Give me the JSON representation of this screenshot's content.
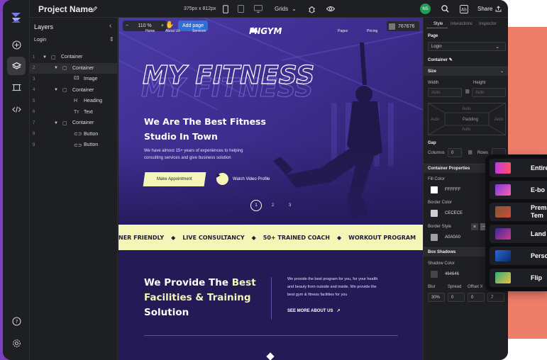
{
  "app": {
    "project_name": "Project Name",
    "viewport": "375px x 812px",
    "grids_label": "Grids",
    "avatar_initials": "NS",
    "share_label": "Share"
  },
  "layers": {
    "title": "Layers",
    "page": "Login",
    "rows": [
      {
        "n": "1",
        "label": "Container",
        "icon": "box-icon",
        "depth": 0,
        "expand": true
      },
      {
        "n": "2",
        "label": "Container",
        "icon": "box-icon",
        "depth": 1,
        "expand": true
      },
      {
        "n": "3",
        "label": "Image",
        "icon": "image-icon",
        "depth": 2,
        "expand": false
      },
      {
        "n": "4",
        "label": "Container",
        "icon": "box-icon",
        "depth": 1,
        "expand": true
      },
      {
        "n": "5",
        "label": "Heading",
        "icon": "heading-icon",
        "depth": 2,
        "expand": false
      },
      {
        "n": "6",
        "label": "Text",
        "icon": "text-icon",
        "depth": 2,
        "expand": false
      },
      {
        "n": "7",
        "label": "Container",
        "icon": "box-icon",
        "depth": 1,
        "expand": true
      },
      {
        "n": "8",
        "label": "Button",
        "icon": "link-icon",
        "depth": 2,
        "expand": false
      },
      {
        "n": "9",
        "label": "Button",
        "icon": "link-icon",
        "depth": 2,
        "expand": false
      }
    ]
  },
  "canvas_toolbar": {
    "zoom": "110 %",
    "add_page": "Add page",
    "color_chip": "767676"
  },
  "site": {
    "brand": "MIGYM",
    "nav": [
      "Home",
      "About Us",
      "Services",
      "Pages",
      "Pricing"
    ],
    "big_title": "MY FITNESS",
    "headline_1": "We Are The Best Fitness",
    "headline_2": "Studio In Town",
    "sub_1": "We have almost 15+ years of experiences to helping",
    "sub_2": "consulting services and give business solution",
    "cta": "Make Appointment",
    "video": "Watch Video Profile",
    "slides": [
      "1",
      "2",
      "3"
    ],
    "marquee": [
      "NER FRIENDLY",
      "LIVE CONSULTANCY",
      "50+ TRAINED COACH",
      "WORKOUT PROGRAM",
      "50"
    ],
    "provide_1a": "We Provide The ",
    "provide_1b": "Best",
    "provide_2": "Facilities & Training",
    "provide_3": "Solution",
    "para_1": "We provide the best program for you, for your health",
    "para_2": "and beauty from outside and inside. We provide the",
    "para_3": "best gym & fitness facilities for you",
    "see_more": "SEE MORE ABOUT US"
  },
  "props": {
    "tabs": [
      "Style",
      "Interactions",
      "Inspector"
    ],
    "page_label": "Page",
    "page_value": "Login",
    "container_label": "Container",
    "size_label": "Size",
    "width_label": "Width",
    "height_label": "Height",
    "auto": "Auto",
    "padding": "Padding",
    "gap_label": "Gap",
    "columns_label": "Columns",
    "columns_value": "0",
    "rows_label": "Rows",
    "container_props": "Container Properties",
    "fill_label": "Fill Color",
    "fill_value": "FFFFFF",
    "border_color_label": "Border Color",
    "border_color_value": "CECECE",
    "border_style_label": "Border Style",
    "border_style_value": "A0A0A0",
    "box_shadows": "Box Shadows",
    "shadow_color_label": "Shadow Color",
    "shadow_color_value": "464646",
    "blur_label": "Blur",
    "spread_label": "Spread",
    "offx_label": "Offset X",
    "blur_value": "30%",
    "spread_value": "0",
    "offx_value": "0",
    "extra_value": "7"
  },
  "templates": [
    "Entire",
    "E-bo",
    "Prem\nTem",
    "Land",
    "Perso",
    "Flip"
  ],
  "colors": {
    "accent": "#f4f6b8",
    "brand_purple": "#7b3fc0",
    "coral": "#ee7d6a",
    "hero_bg": "#3b2a8a",
    "lower_bg": "#241a55",
    "active_blue": "#2f6fd6"
  }
}
